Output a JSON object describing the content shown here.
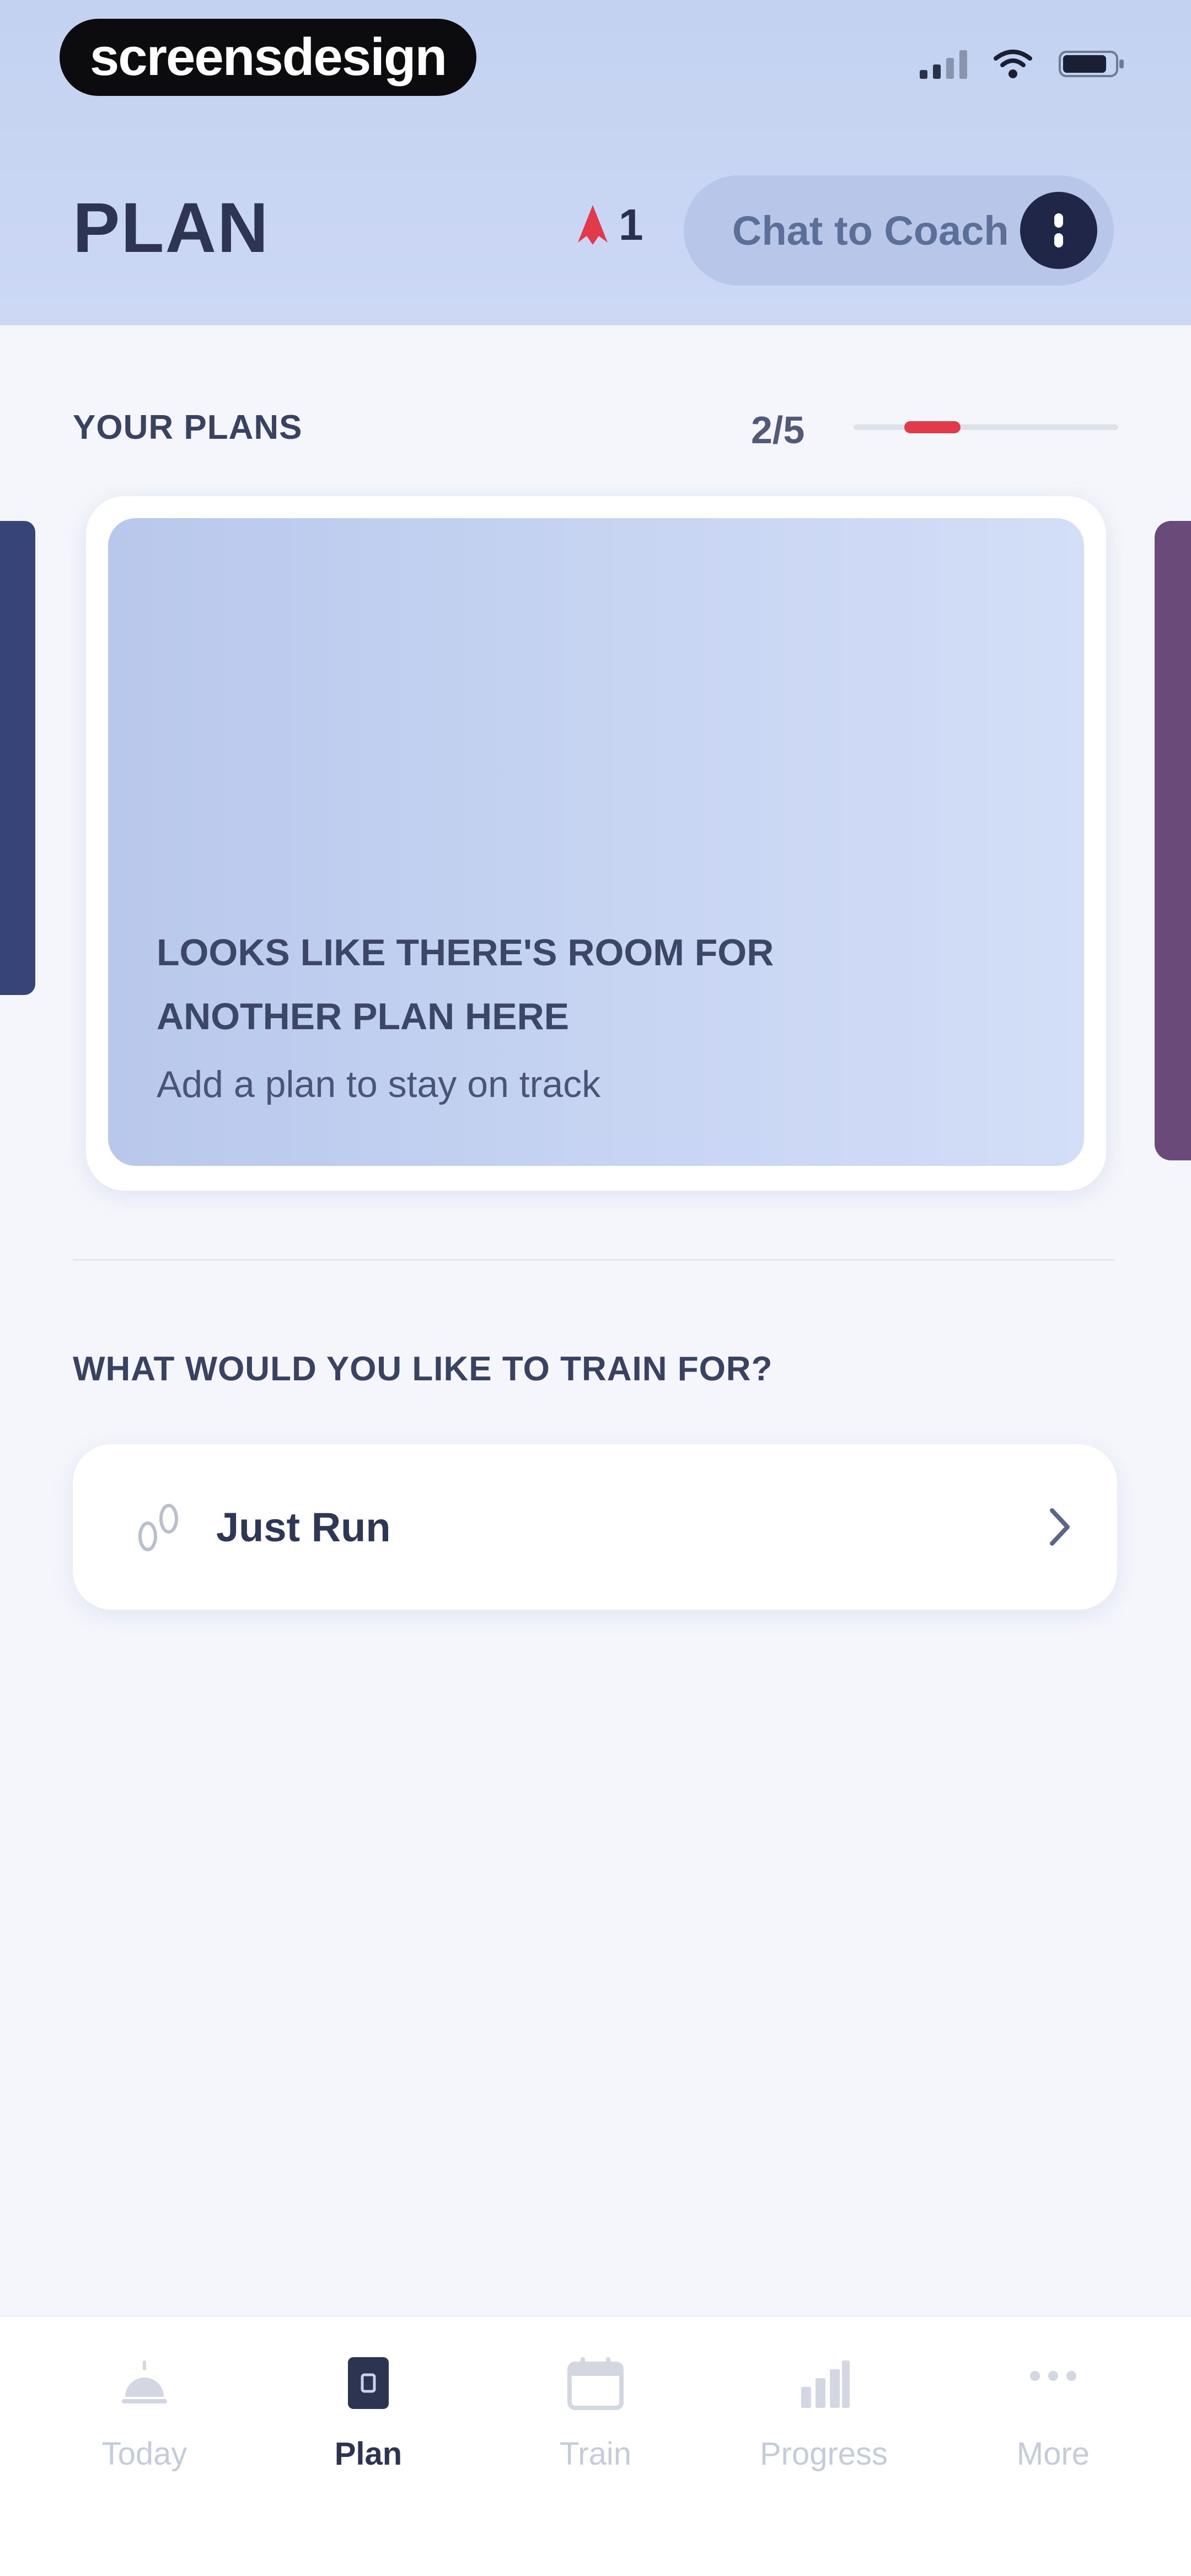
{
  "watermark": "screensdesign",
  "header": {
    "title": "PLAN",
    "streak_count": "1",
    "coach_button_label": "Chat to Coach"
  },
  "plans": {
    "section_title": "YOUR PLANS",
    "counter": "2/5",
    "empty_card": {
      "title": "LOOKS LIKE THERE'S ROOM FOR ANOTHER PLAN HERE",
      "subtitle": "Add a plan to stay on track"
    }
  },
  "train": {
    "section_title": "WHAT WOULD YOU LIKE TO TRAIN FOR?",
    "options": [
      {
        "label": "Just Run",
        "icon": "footprints-icon"
      }
    ]
  },
  "nav": {
    "items": [
      {
        "label": "Today",
        "icon": "sunrise-icon",
        "active": false
      },
      {
        "label": "Plan",
        "icon": "plan-icon",
        "active": true
      },
      {
        "label": "Train",
        "icon": "calendar-icon",
        "active": false
      },
      {
        "label": "Progress",
        "icon": "bar-chart-icon",
        "active": false
      },
      {
        "label": "More",
        "icon": "more-dots-icon",
        "active": false
      }
    ]
  },
  "colors": {
    "accent": "#e13a4a",
    "header_bg": "#c8d6f3",
    "dark_navy": "#1f2648"
  }
}
